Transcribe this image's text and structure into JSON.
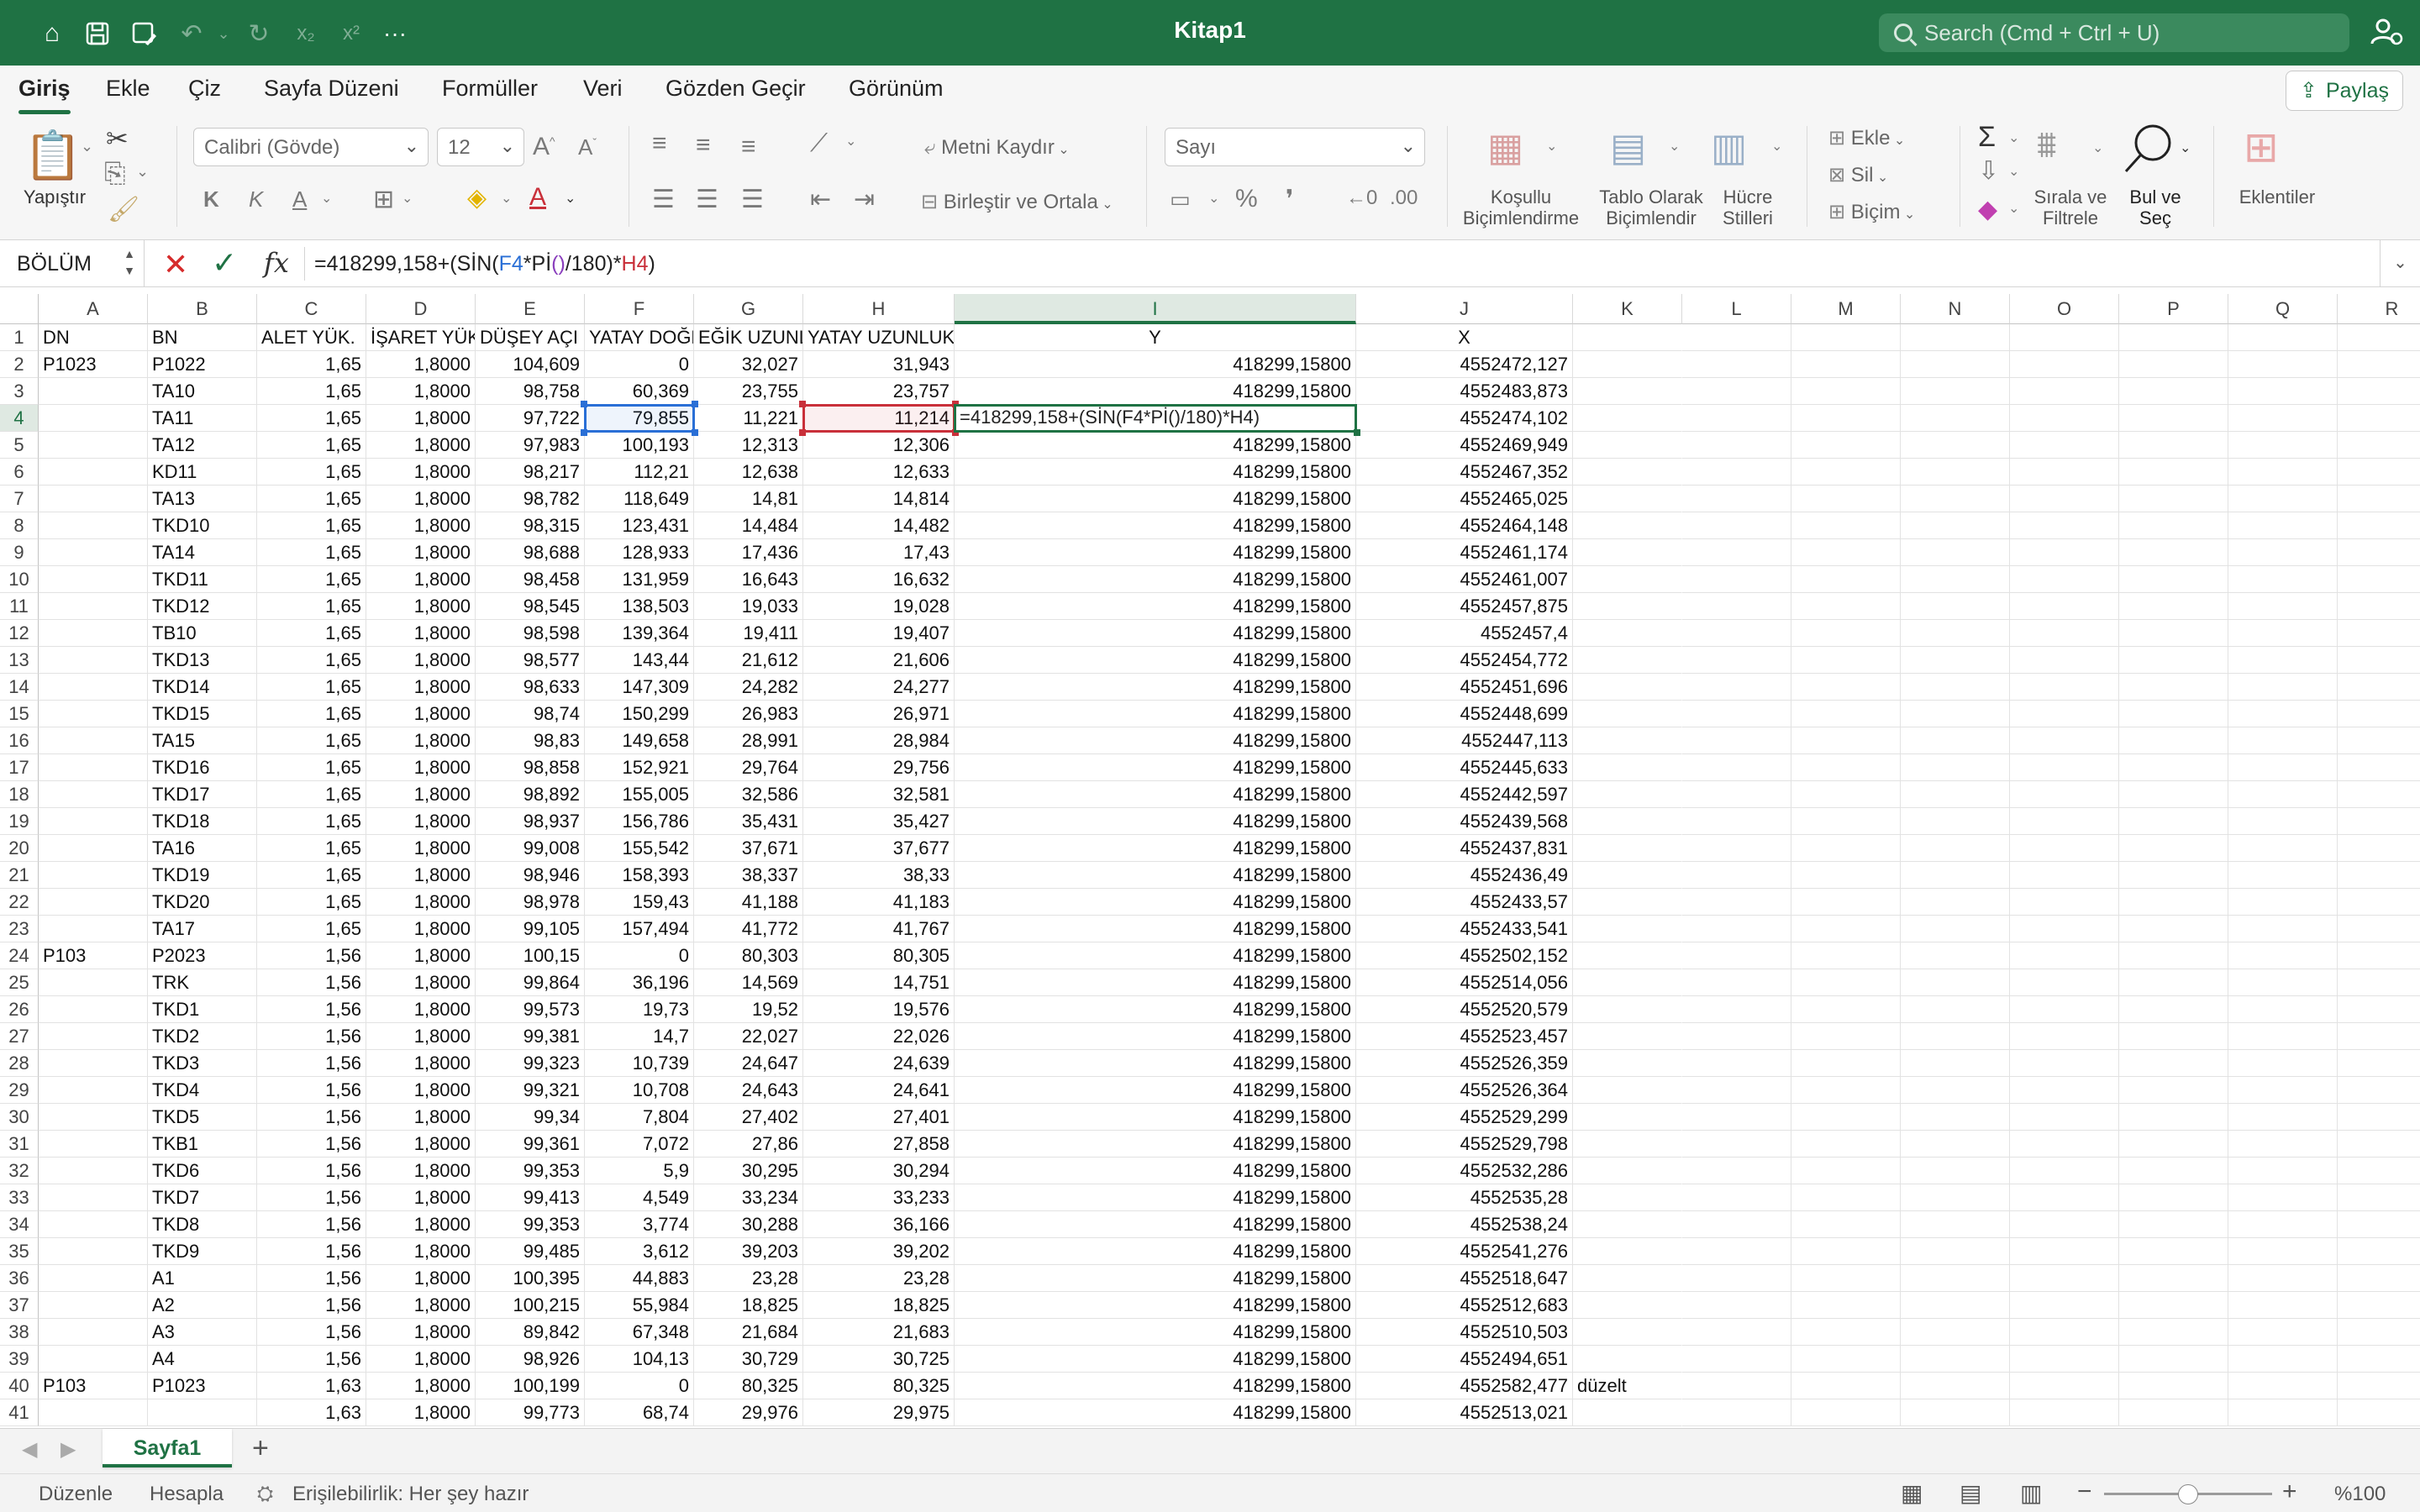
{
  "titlebar": {
    "title": "Kitap1",
    "search_placeholder": "Search (Cmd + Ctrl + U)",
    "subscript_label": "x₂",
    "superscript_label": "x²",
    "more_label": "···"
  },
  "tabs": [
    "Giriş",
    "Ekle",
    "Çiz",
    "Sayfa Düzeni",
    "Formüller",
    "Veri",
    "Gözden Geçir",
    "Görünüm"
  ],
  "share_label": "Paylaş",
  "ribbon": {
    "paste_label": "Yapıştır",
    "font_name": "Calibri (Gövde)",
    "font_size": "12",
    "bold": "K",
    "italic": "K",
    "underline": "A",
    "wrap_text": "Metni Kaydır",
    "merge_center": "Birleştir ve Ortala",
    "number_format": "Sayı",
    "percent": "%",
    "conditional_format": [
      "Koşullu",
      "Biçimlendirme"
    ],
    "format_table": [
      "Tablo Olarak",
      "Biçimlendir"
    ],
    "cell_styles": [
      "Hücre",
      "Stilleri"
    ],
    "insert": "Ekle",
    "delete": "Sil",
    "format": "Biçim",
    "sort_filter": [
      "Sırala ve",
      "Filtrele"
    ],
    "find_select": [
      "Bul ve",
      "Seç"
    ],
    "addins": "Eklentiler"
  },
  "formula_bar": {
    "name_box": "BÖLÜM",
    "formula_parts": [
      {
        "t": "=418299,158+(SİN(",
        "c": ""
      },
      {
        "t": "F4",
        "c": "b"
      },
      {
        "t": "*Pİ",
        "c": ""
      },
      {
        "t": "()",
        "c": "p"
      },
      {
        "t": "/180)*",
        "c": ""
      },
      {
        "t": "H4",
        "c": "r"
      },
      {
        "t": ")",
        "c": ""
      }
    ]
  },
  "columns": [
    "A",
    "B",
    "C",
    "D",
    "E",
    "F",
    "G",
    "H",
    "I",
    "J",
    "K",
    "L",
    "M",
    "N",
    "O",
    "P",
    "Q",
    "R"
  ],
  "header_row": [
    "DN",
    "BN",
    "ALET YÜK.",
    "İŞARET YÜK.",
    "DÜŞEY AÇI",
    "YATAY DOĞR",
    "EĞİK UZUNL",
    "YATAY UZUNLUK",
    "Y",
    "X"
  ],
  "rows": [
    [
      "P1023",
      "P1022",
      "1,65",
      "1,8000",
      "104,609",
      "0",
      "32,027",
      "31,943",
      "418299,15800",
      "4552472,127"
    ],
    [
      "",
      "TA10",
      "1,65",
      "1,8000",
      "98,758",
      "60,369",
      "23,755",
      "23,757",
      "418299,15800",
      "4552483,873"
    ],
    [
      "",
      "TA11",
      "1,65",
      "1,8000",
      "97,722",
      "79,855",
      "11,221",
      "11,214",
      "=418299,158+(SİN(F4*Pİ()/180)*H4)",
      "4552474,102"
    ],
    [
      "",
      "TA12",
      "1,65",
      "1,8000",
      "97,983",
      "100,193",
      "12,313",
      "12,306",
      "418299,15800",
      "4552469,949"
    ],
    [
      "",
      "KD11",
      "1,65",
      "1,8000",
      "98,217",
      "112,21",
      "12,638",
      "12,633",
      "418299,15800",
      "4552467,352"
    ],
    [
      "",
      "TA13",
      "1,65",
      "1,8000",
      "98,782",
      "118,649",
      "14,81",
      "14,814",
      "418299,15800",
      "4552465,025"
    ],
    [
      "",
      "TKD10",
      "1,65",
      "1,8000",
      "98,315",
      "123,431",
      "14,484",
      "14,482",
      "418299,15800",
      "4552464,148"
    ],
    [
      "",
      "TA14",
      "1,65",
      "1,8000",
      "98,688",
      "128,933",
      "17,436",
      "17,43",
      "418299,15800",
      "4552461,174"
    ],
    [
      "",
      "TKD11",
      "1,65",
      "1,8000",
      "98,458",
      "131,959",
      "16,643",
      "16,632",
      "418299,15800",
      "4552461,007"
    ],
    [
      "",
      "TKD12",
      "1,65",
      "1,8000",
      "98,545",
      "138,503",
      "19,033",
      "19,028",
      "418299,15800",
      "4552457,875"
    ],
    [
      "",
      "TB10",
      "1,65",
      "1,8000",
      "98,598",
      "139,364",
      "19,411",
      "19,407",
      "418299,15800",
      "4552457,4"
    ],
    [
      "",
      "TKD13",
      "1,65",
      "1,8000",
      "98,577",
      "143,44",
      "21,612",
      "21,606",
      "418299,15800",
      "4552454,772"
    ],
    [
      "",
      "TKD14",
      "1,65",
      "1,8000",
      "98,633",
      "147,309",
      "24,282",
      "24,277",
      "418299,15800",
      "4552451,696"
    ],
    [
      "",
      "TKD15",
      "1,65",
      "1,8000",
      "98,74",
      "150,299",
      "26,983",
      "26,971",
      "418299,15800",
      "4552448,699"
    ],
    [
      "",
      "TA15",
      "1,65",
      "1,8000",
      "98,83",
      "149,658",
      "28,991",
      "28,984",
      "418299,15800",
      "4552447,113"
    ],
    [
      "",
      "TKD16",
      "1,65",
      "1,8000",
      "98,858",
      "152,921",
      "29,764",
      "29,756",
      "418299,15800",
      "4552445,633"
    ],
    [
      "",
      "TKD17",
      "1,65",
      "1,8000",
      "98,892",
      "155,005",
      "32,586",
      "32,581",
      "418299,15800",
      "4552442,597"
    ],
    [
      "",
      "TKD18",
      "1,65",
      "1,8000",
      "98,937",
      "156,786",
      "35,431",
      "35,427",
      "418299,15800",
      "4552439,568"
    ],
    [
      "",
      "TA16",
      "1,65",
      "1,8000",
      "99,008",
      "155,542",
      "37,671",
      "37,677",
      "418299,15800",
      "4552437,831"
    ],
    [
      "",
      "TKD19",
      "1,65",
      "1,8000",
      "98,946",
      "158,393",
      "38,337",
      "38,33",
      "418299,15800",
      "4552436,49"
    ],
    [
      "",
      "TKD20",
      "1,65",
      "1,8000",
      "98,978",
      "159,43",
      "41,188",
      "41,183",
      "418299,15800",
      "4552433,57"
    ],
    [
      "",
      "TA17",
      "1,65",
      "1,8000",
      "99,105",
      "157,494",
      "41,772",
      "41,767",
      "418299,15800",
      "4552433,541"
    ],
    [
      "P103",
      "P2023",
      "1,56",
      "1,8000",
      "100,15",
      "0",
      "80,303",
      "80,305",
      "418299,15800",
      "4552502,152"
    ],
    [
      "",
      "TRK",
      "1,56",
      "1,8000",
      "99,864",
      "36,196",
      "14,569",
      "14,751",
      "418299,15800",
      "4552514,056"
    ],
    [
      "",
      "TKD1",
      "1,56",
      "1,8000",
      "99,573",
      "19,73",
      "19,52",
      "19,576",
      "418299,15800",
      "4552520,579"
    ],
    [
      "",
      "TKD2",
      "1,56",
      "1,8000",
      "99,381",
      "14,7",
      "22,027",
      "22,026",
      "418299,15800",
      "4552523,457"
    ],
    [
      "",
      "TKD3",
      "1,56",
      "1,8000",
      "99,323",
      "10,739",
      "24,647",
      "24,639",
      "418299,15800",
      "4552526,359"
    ],
    [
      "",
      "TKD4",
      "1,56",
      "1,8000",
      "99,321",
      "10,708",
      "24,643",
      "24,641",
      "418299,15800",
      "4552526,364"
    ],
    [
      "",
      "TKD5",
      "1,56",
      "1,8000",
      "99,34",
      "7,804",
      "27,402",
      "27,401",
      "418299,15800",
      "4552529,299"
    ],
    [
      "",
      "TKB1",
      "1,56",
      "1,8000",
      "99,361",
      "7,072",
      "27,86",
      "27,858",
      "418299,15800",
      "4552529,798"
    ],
    [
      "",
      "TKD6",
      "1,56",
      "1,8000",
      "99,353",
      "5,9",
      "30,295",
      "30,294",
      "418299,15800",
      "4552532,286"
    ],
    [
      "",
      "TKD7",
      "1,56",
      "1,8000",
      "99,413",
      "4,549",
      "33,234",
      "33,233",
      "418299,15800",
      "4552535,28"
    ],
    [
      "",
      "TKD8",
      "1,56",
      "1,8000",
      "99,353",
      "3,774",
      "30,288",
      "36,166",
      "418299,15800",
      "4552538,24"
    ],
    [
      "",
      "TKD9",
      "1,56",
      "1,8000",
      "99,485",
      "3,612",
      "39,203",
      "39,202",
      "418299,15800",
      "4552541,276"
    ],
    [
      "",
      "A1",
      "1,56",
      "1,8000",
      "100,395",
      "44,883",
      "23,28",
      "23,28",
      "418299,15800",
      "4552518,647"
    ],
    [
      "",
      "A2",
      "1,56",
      "1,8000",
      "100,215",
      "55,984",
      "18,825",
      "18,825",
      "418299,15800",
      "4552512,683"
    ],
    [
      "",
      "A3",
      "1,56",
      "1,8000",
      "89,842",
      "67,348",
      "21,684",
      "21,683",
      "418299,15800",
      "4552510,503"
    ],
    [
      "",
      "A4",
      "1,56",
      "1,8000",
      "98,926",
      "104,13",
      "30,729",
      "30,725",
      "418299,15800",
      "4552494,651"
    ],
    [
      "P103",
      "P1023",
      "1,63",
      "1,8000",
      "100,199",
      "0",
      "80,325",
      "80,325",
      "418299,15800",
      "4552582,477",
      "düzelt"
    ],
    [
      "",
      "",
      "1,63",
      "1,8000",
      "99,773",
      "68,74",
      "29,976",
      "29,975",
      "418299,15800",
      "4552513,021"
    ]
  ],
  "sheet_tab": "Sayfa1",
  "status": {
    "mode": "Düzenle",
    "calc": "Hesapla",
    "accessibility": "Erişilebilirlik: Her şey hazır",
    "zoom": "%100",
    "zoom_level": 100
  },
  "colors": {
    "accent": "#1f7244",
    "ref_blue": "#2a6fd6",
    "ref_red": "#c9303a"
  }
}
